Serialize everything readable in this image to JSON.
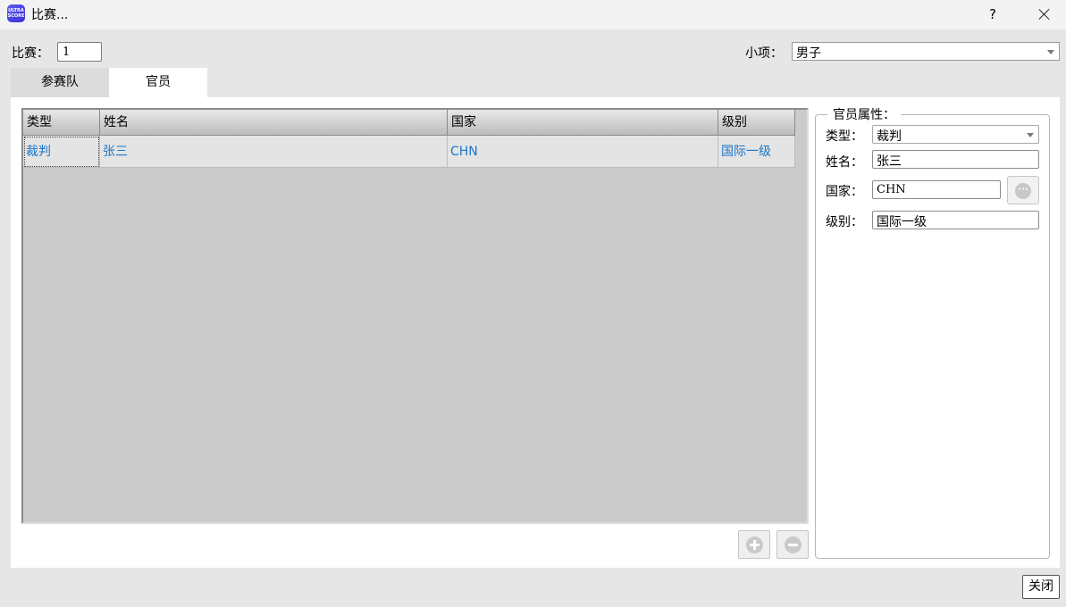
{
  "window": {
    "title": "比赛...",
    "help": "?",
    "app_icon_text": "ULTRA SCORE"
  },
  "header": {
    "match_label": "比赛：",
    "match_value": "1",
    "event_label": "小项：",
    "event_value": "男子"
  },
  "tabs": [
    {
      "label": "参赛队",
      "active": false
    },
    {
      "label": "官员",
      "active": true
    }
  ],
  "grid": {
    "columns": [
      "类型",
      "姓名",
      "国家",
      "级别"
    ],
    "rows": [
      [
        "裁判",
        "张三",
        "CHN",
        "国际一级"
      ]
    ]
  },
  "properties": {
    "title": "官员属性：",
    "type_label": "类型：",
    "type_value": "裁判",
    "name_label": "姓名：",
    "name_value": "张三",
    "country_label": "国家：",
    "country_value": "CHN",
    "level_label": "级别：",
    "level_value": "国际一级"
  },
  "footer": {
    "close_label": "关闭"
  },
  "colors": {
    "cell_text": "#1b76c6",
    "grid_bg": "#cbcbcb"
  },
  "icons": [
    "app-icon",
    "help-icon",
    "close-icon",
    "add-icon",
    "remove-icon",
    "more-icon",
    "chevron-down-icon"
  ]
}
